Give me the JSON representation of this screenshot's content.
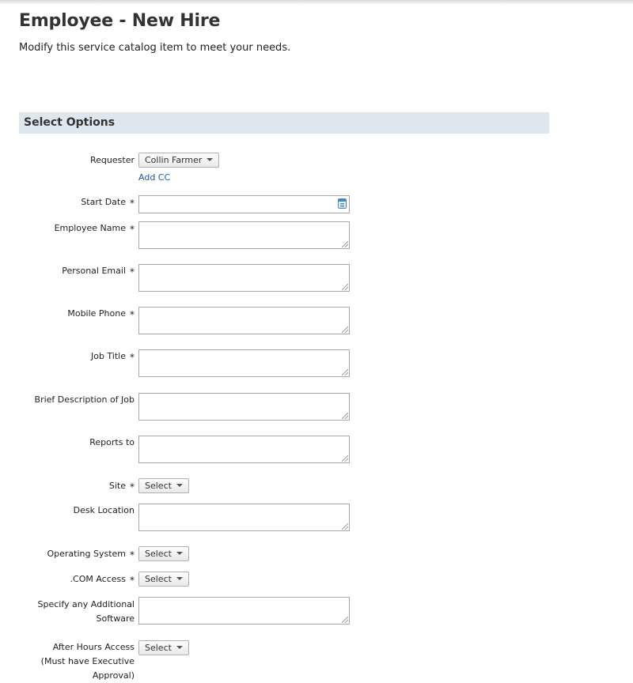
{
  "header": {
    "title": "Employee - New Hire",
    "subtitle": "Modify this service catalog item to meet your needs."
  },
  "section": {
    "title": "Select Options"
  },
  "requester": {
    "label": "Requester",
    "value": "Collin Farmer",
    "add_cc": "Add CC"
  },
  "fields": {
    "start_date": {
      "label": "Start Date",
      "required": "*",
      "value": ""
    },
    "employee_name": {
      "label": "Employee Name",
      "required": "*",
      "value": ""
    },
    "personal_email": {
      "label": "Personal Email",
      "required": "*",
      "value": ""
    },
    "mobile_phone": {
      "label": "Mobile Phone",
      "required": "*",
      "value": ""
    },
    "job_title": {
      "label": "Job Title",
      "required": "*",
      "value": ""
    },
    "brief_description": {
      "label": "Brief Description of Job",
      "value": ""
    },
    "reports_to": {
      "label": "Reports to",
      "value": ""
    },
    "site": {
      "label": "Site",
      "required": "*",
      "value": "Select"
    },
    "desk_location": {
      "label": "Desk Location",
      "value": ""
    },
    "operating_system": {
      "label": "Operating System",
      "required": "*",
      "value": "Select"
    },
    "com_access": {
      "label": ".COM Access",
      "required": "*",
      "value": "Select"
    },
    "additional_software": {
      "label": "Specify any Additional Software",
      "value": ""
    },
    "after_hours_access": {
      "label": "After Hours Access (Must have Executive Approval)",
      "value": "Select"
    }
  }
}
